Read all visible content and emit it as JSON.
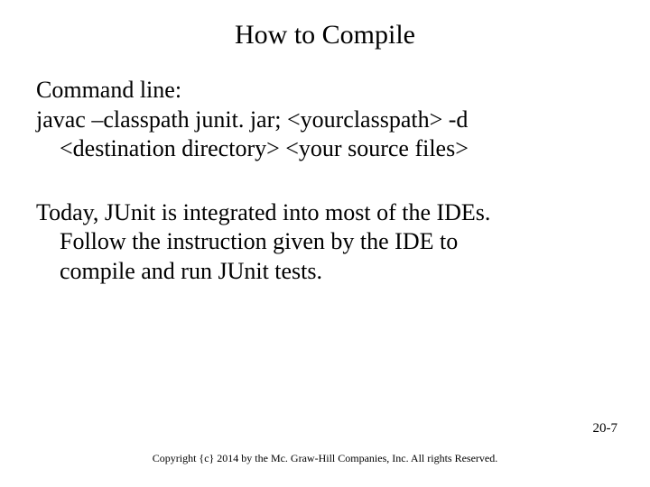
{
  "slide": {
    "title": "How to Compile",
    "command_label": "Command line:",
    "command_line1": "javac –classpath junit. jar; <yourclasspath> -d",
    "command_line2": "<destination directory> <your source files>",
    "para2_line1": "Today, JUnit is integrated into most of the IDEs.",
    "para2_line2": "Follow the instruction given by the IDE to",
    "para2_line3": "compile and run JUnit tests.",
    "page_number": "20-7",
    "copyright": "Copyright {c} 2014 by the Mc. Graw-Hill Companies, Inc. All rights Reserved."
  }
}
